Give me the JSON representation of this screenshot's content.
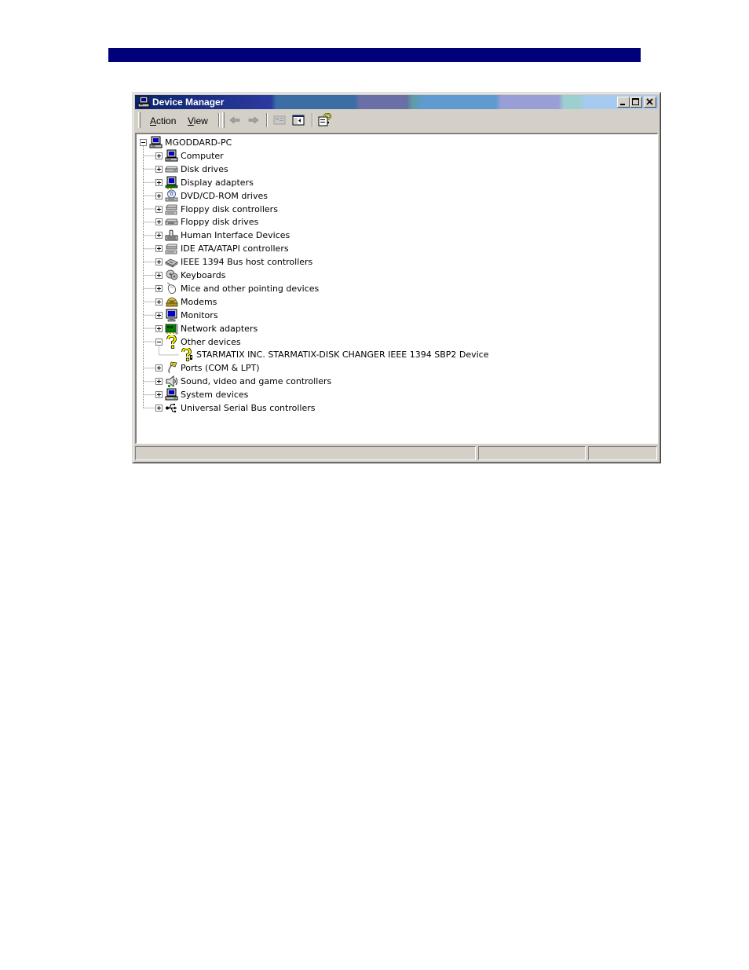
{
  "window": {
    "title": "Device Manager",
    "minimize_glyph": "_",
    "maximize_glyph": "□",
    "close_glyph": "×"
  },
  "menu": {
    "action": "Action",
    "view": "View"
  },
  "toolbar": {
    "icons": [
      "back-arrow-icon",
      "forward-arrow-icon",
      "properties-icon",
      "show-hide-tree-icon",
      "help-icon"
    ]
  },
  "tree": {
    "root": {
      "label": "MGODDARD-PC",
      "expanded": true,
      "icon": "computer-icon"
    },
    "items": [
      {
        "label": "Computer",
        "expanded": false,
        "icon": "computer-icon"
      },
      {
        "label": "Disk drives",
        "expanded": false,
        "icon": "disk-drive-icon"
      },
      {
        "label": "Display adapters",
        "expanded": false,
        "icon": "display-adapter-icon"
      },
      {
        "label": "DVD/CD-ROM drives",
        "expanded": false,
        "icon": "cdrom-icon"
      },
      {
        "label": "Floppy disk controllers",
        "expanded": false,
        "icon": "controller-icon"
      },
      {
        "label": "Floppy disk drives",
        "expanded": false,
        "icon": "floppy-icon"
      },
      {
        "label": "Human Interface Devices",
        "expanded": false,
        "icon": "hid-icon"
      },
      {
        "label": "IDE ATA/ATAPI controllers",
        "expanded": false,
        "icon": "controller-icon"
      },
      {
        "label": "IEEE 1394 Bus host controllers",
        "expanded": false,
        "icon": "ieee1394-icon"
      },
      {
        "label": "Keyboards",
        "expanded": false,
        "icon": "keyboard-icon"
      },
      {
        "label": "Mice and other pointing devices",
        "expanded": false,
        "icon": "mouse-icon"
      },
      {
        "label": "Modems",
        "expanded": false,
        "icon": "modem-icon"
      },
      {
        "label": "Monitors",
        "expanded": false,
        "icon": "monitor-icon"
      },
      {
        "label": "Network adapters",
        "expanded": false,
        "icon": "network-adapter-icon"
      },
      {
        "label": "Other devices",
        "expanded": true,
        "icon": "question-mark-icon",
        "children": [
          {
            "label": "STARMATIX INC. STARMATIX-DISK CHANGER IEEE 1394 SBP2 Device",
            "icon": "unknown-device-warning-icon"
          }
        ]
      },
      {
        "label": "Ports (COM & LPT)",
        "expanded": false,
        "icon": "port-icon"
      },
      {
        "label": "Sound, video and game controllers",
        "expanded": false,
        "icon": "speaker-icon"
      },
      {
        "label": "System devices",
        "expanded": false,
        "icon": "system-device-icon"
      },
      {
        "label": "Universal Serial Bus controllers",
        "expanded": false,
        "icon": "usb-icon"
      }
    ]
  },
  "colors": {
    "page_bar": "#00007a",
    "window_face": "#d4d0c8",
    "title_bar_start": "#0a246a"
  }
}
